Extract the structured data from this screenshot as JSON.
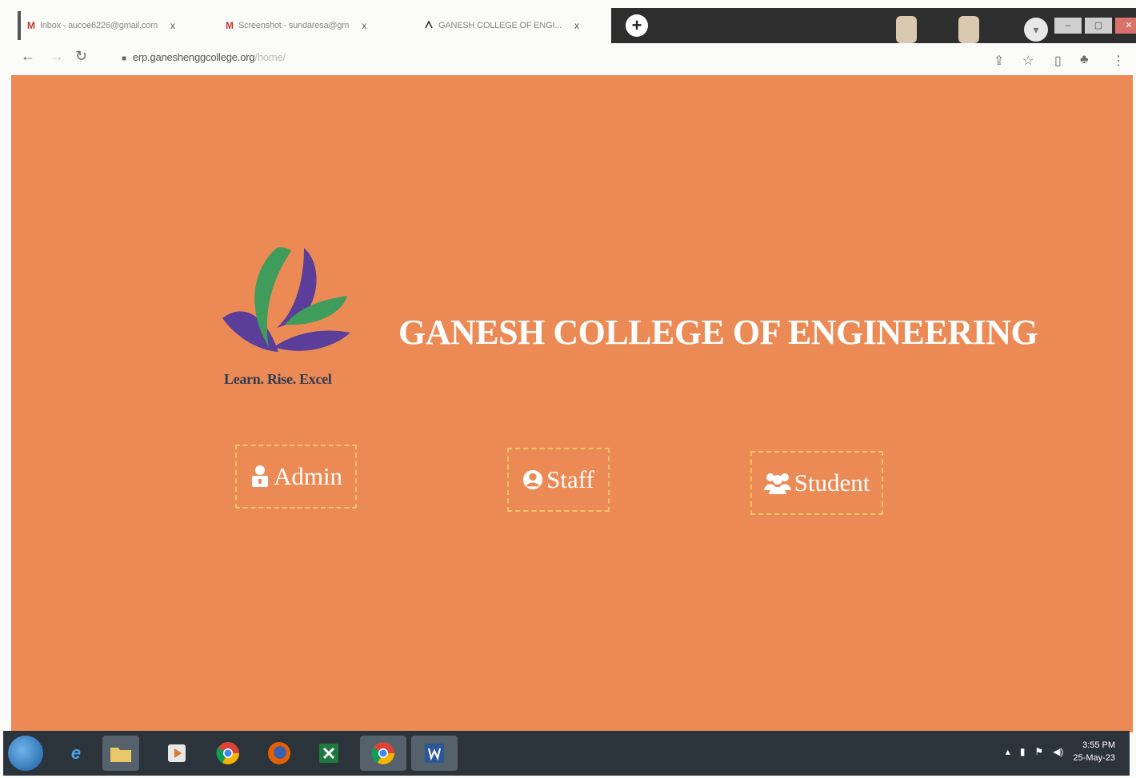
{
  "browser": {
    "tabs": [
      {
        "icon": "gmail-icon",
        "glyph": "M",
        "title": "Inbox - aucoe6226@gmail.com"
      },
      {
        "icon": "gmail-icon",
        "glyph": "M",
        "title": "Screenshot - sundaresa@gm"
      },
      {
        "icon": "college-logo-icon",
        "glyph": "ꟽ",
        "title": "GANESH COLLEGE OF ENGI..."
      }
    ],
    "new_tab_label": "+",
    "url_host": "erp.ganeshenggcollege.org",
    "url_path": "/home/",
    "close_glyph": "x"
  },
  "page": {
    "background": "#ec8a55",
    "college_name": "GANESH COLLEGE OF ENGINEERING",
    "tagline": "Learn. Rise. Excel",
    "roles": {
      "admin": {
        "label": "Admin",
        "icon": "user-lock-icon"
      },
      "staff": {
        "label": "Staff",
        "icon": "user-circle-icon"
      },
      "student": {
        "label": "Student",
        "icon": "users-icon"
      }
    }
  },
  "taskbar": {
    "time": "3:55 PM",
    "date": "25-May-23"
  }
}
